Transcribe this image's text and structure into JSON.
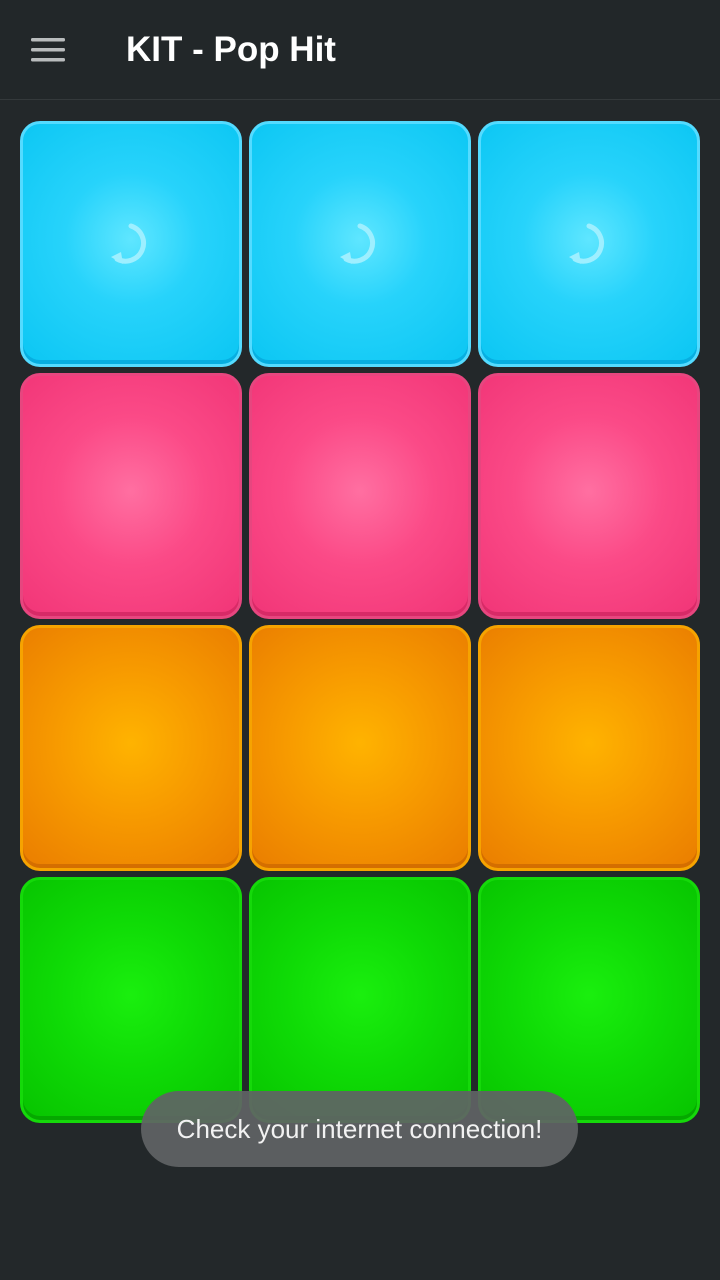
{
  "app_bar": {
    "menu_icon": "hamburger-menu-icon",
    "title": "KIT - Pop Hit"
  },
  "pads": [
    {
      "row": 1,
      "color": "#0bc6f3",
      "icon": "loop-icon"
    },
    {
      "row": 1,
      "color": "#0bc6f3",
      "icon": "loop-icon"
    },
    {
      "row": 1,
      "color": "#0bc6f3",
      "icon": "loop-icon"
    },
    {
      "row": 2,
      "color": "#f13577",
      "icon": ""
    },
    {
      "row": 2,
      "color": "#f13577",
      "icon": ""
    },
    {
      "row": 2,
      "color": "#f13577",
      "icon": ""
    },
    {
      "row": 3,
      "color": "#ea7d00",
      "icon": ""
    },
    {
      "row": 3,
      "color": "#ea7d00",
      "icon": ""
    },
    {
      "row": 3,
      "color": "#ea7d00",
      "icon": ""
    },
    {
      "row": 4,
      "color": "#07c300",
      "icon": ""
    },
    {
      "row": 4,
      "color": "#07c300",
      "icon": ""
    },
    {
      "row": 4,
      "color": "#07c300",
      "icon": ""
    }
  ],
  "toast": {
    "message": "Check your internet connection!"
  },
  "colors": {
    "background": "#23282a",
    "pad_blue": "#0bc6f3",
    "pad_pink": "#f13577",
    "pad_orange": "#ea7d00",
    "pad_green": "#07c300"
  }
}
